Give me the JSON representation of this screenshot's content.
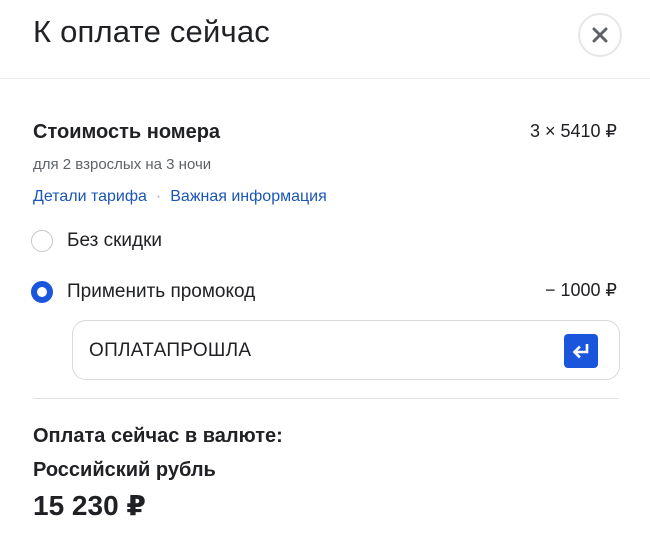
{
  "header": {
    "title": "К оплате сейчас",
    "close_icon": "close-icon"
  },
  "room": {
    "title": "Стоимость номера",
    "price": "3 × 5410 ₽",
    "subtitle": "для 2 взрослых на 3 ночи",
    "links": {
      "tariff": "Детали тарифа",
      "separator": "·",
      "info": "Важная информация"
    }
  },
  "options": {
    "no_discount": {
      "label": "Без скидки",
      "selected": false
    },
    "promo": {
      "label": "Применить промокод",
      "selected": true,
      "discount": "− 1000 ₽"
    }
  },
  "promo_field": {
    "value": "ОПЛАТАПРОШЛА",
    "submit_icon": "enter-return-icon"
  },
  "payment": {
    "title_line1": "Оплата сейчас в валюте:",
    "title_line2": "Российский рубль",
    "total": "15 230 ₽"
  },
  "colors": {
    "accent": "#1a56db",
    "link": "#1a56b8",
    "text": "#202124",
    "muted": "#5f6368"
  }
}
